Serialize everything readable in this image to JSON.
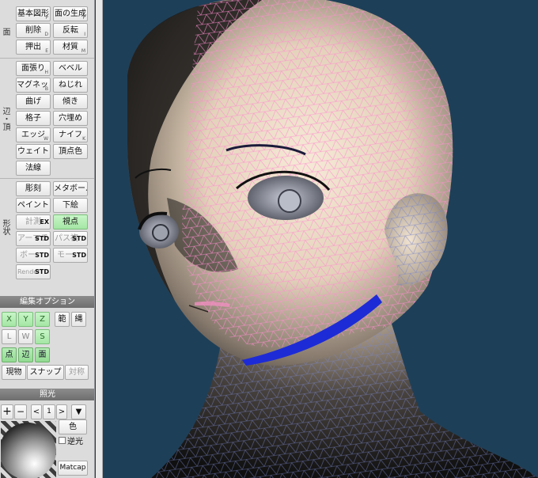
{
  "panel": {
    "group1_label": "面",
    "group2_label": "辺・頂",
    "group3_label": "形状",
    "row1": [
      {
        "label": "基本図形",
        "key": "P"
      },
      {
        "label": "面の生成",
        "key": "F"
      }
    ],
    "row2": [
      {
        "label": "削除",
        "key": "D"
      },
      {
        "label": "反転",
        "key": "I"
      }
    ],
    "row3": [
      {
        "label": "押出",
        "key": "E"
      },
      {
        "label": "材質",
        "key": "M"
      }
    ],
    "row4": [
      {
        "label": "面張り",
        "key": "H"
      },
      {
        "label": "ベベル",
        "key": ""
      }
    ],
    "row5": [
      {
        "label": "マグネット",
        "key": "B"
      },
      {
        "label": "ねじれ",
        "key": ""
      }
    ],
    "row6": [
      {
        "label": "曲げ",
        "key": ""
      },
      {
        "label": "傾き",
        "key": ""
      }
    ],
    "row7": [
      {
        "label": "格子",
        "key": ""
      },
      {
        "label": "穴埋め",
        "key": ""
      }
    ],
    "row8": [
      {
        "label": "エッジ",
        "key": "W"
      },
      {
        "label": "ナイフ",
        "key": "K"
      }
    ],
    "row9": [
      {
        "label": "ウェイト",
        "key": ""
      },
      {
        "label": "頂点色",
        "key": ""
      }
    ],
    "row10": [
      {
        "label": "法線",
        "key": ""
      }
    ],
    "row11": [
      {
        "label": "彫刻",
        "key": ""
      },
      {
        "label": "メタボール",
        "key": ""
      }
    ],
    "row12": [
      {
        "label": "ペイント",
        "key": ""
      },
      {
        "label": "下絵",
        "key": ""
      }
    ],
    "row13": [
      {
        "label": "計測",
        "tag": "EX"
      },
      {
        "label": "視点",
        "tag": ""
      }
    ],
    "row14": [
      {
        "label": "アーマチ",
        "tag": "STD"
      },
      {
        "label": "パス複",
        "tag": "STD"
      }
    ],
    "row15": [
      {
        "label": "ボー",
        "tag": "STD"
      },
      {
        "label": "モー",
        "tag": "STD"
      }
    ],
    "row16": [
      {
        "label": "Render",
        "tag": "STD"
      }
    ],
    "edit_options_header": "編集オプション",
    "axis_x": "X",
    "axis_y": "Y",
    "axis_z": "Z",
    "range_btn": "範",
    "rope_btn": "縄",
    "coord_l": "L",
    "coord_w": "W",
    "coord_s": "S",
    "sel_point": "点",
    "sel_edge": "辺",
    "sel_face": "面",
    "current_obj": "現物",
    "snap": "スナップ",
    "symmetry": "対称",
    "lighting_header": "照光",
    "plus": "+",
    "minus": "−",
    "prev": "<",
    "light_index": "1",
    "next": ">",
    "dropdown": "▼",
    "color_btn": "色",
    "backlight_label": "逆光",
    "matcap_btn": "Matcap"
  },
  "colors": {
    "viewport_bg": "#1e3f58",
    "wire_selected": "#ff8ccf",
    "wire_unselected": "#7a86c8",
    "active_green": "#a4e6a4"
  }
}
